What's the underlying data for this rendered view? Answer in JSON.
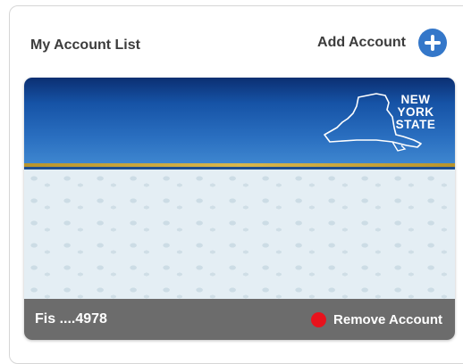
{
  "header": {
    "title": "My Account List",
    "add_account_label": "Add Account",
    "add_icon": "plus-circle-icon",
    "accent_color": "#3477c9"
  },
  "card": {
    "logo_line1": "NEW",
    "logo_line2": "YORK",
    "logo_line3": "STATE",
    "account_number": "Fis ....4978",
    "remove_label": "Remove Account",
    "remove_icon": "red-dot-icon",
    "remove_color": "#e8121c"
  }
}
